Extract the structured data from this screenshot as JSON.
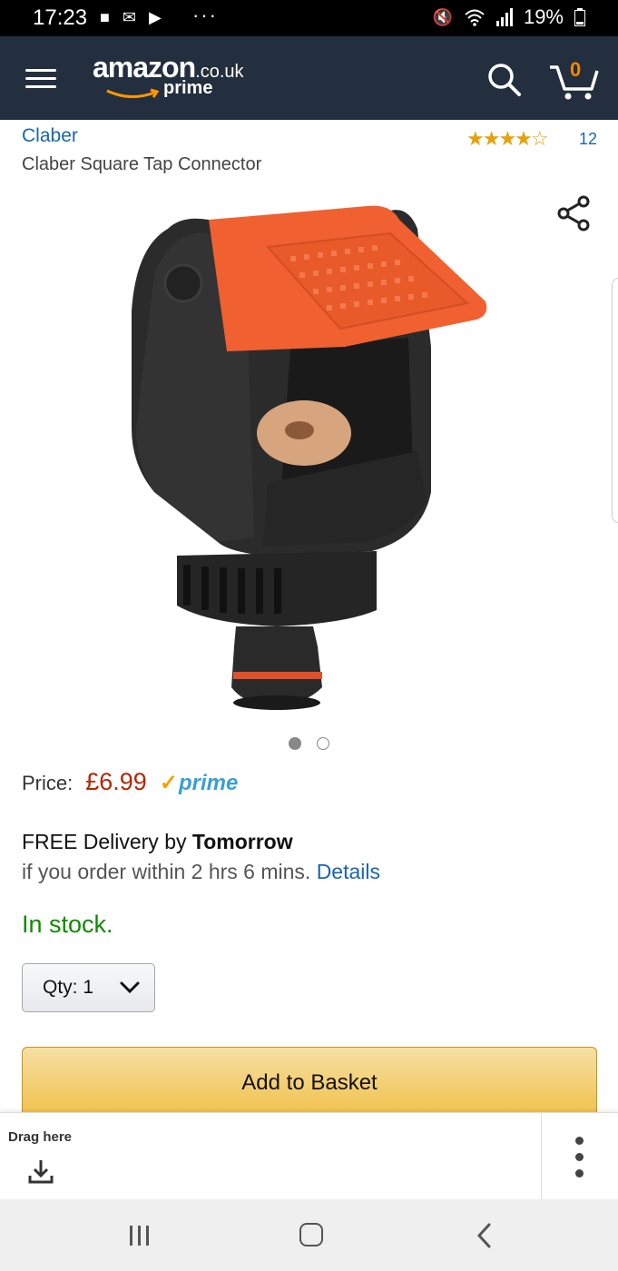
{
  "status_bar": {
    "time": "17:23",
    "battery": "19%"
  },
  "nav": {
    "logo_word": "amazon",
    "logo_tld": ".co.uk",
    "logo_prime": "prime",
    "cart_count": "0"
  },
  "product": {
    "brand": "Claber",
    "title": "Claber Square Tap Connector",
    "stars": "★★★★☆",
    "rating_count": "12",
    "image_index": 1,
    "image_total": 2,
    "price_label": "Price:",
    "price_value": "£6.99",
    "prime_label": "prime"
  },
  "delivery": {
    "line1_prefix": "FREE Delivery by ",
    "line1_bold": "Tomorrow",
    "line2_text": "if you order within 2 hrs 6 mins.",
    "line2_link": "Details"
  },
  "stock": "In stock.",
  "quantity": {
    "label": "Qty:",
    "value": "1"
  },
  "add_to_basket": "Add to Basket",
  "drag_panel": {
    "label": "Drag here"
  },
  "colors": {
    "nav_bg": "#232f3e",
    "link": "#1a66a8",
    "price": "#b12704",
    "stock": "#118a00",
    "button": "#f0c14b",
    "stars": "#e5a10c"
  },
  "icons": [
    "menu-icon",
    "search-icon",
    "cart-icon",
    "share-icon",
    "chevron-down-icon",
    "download-icon",
    "more-vertical-icon",
    "recent-apps-icon",
    "home-icon",
    "back-icon"
  ]
}
